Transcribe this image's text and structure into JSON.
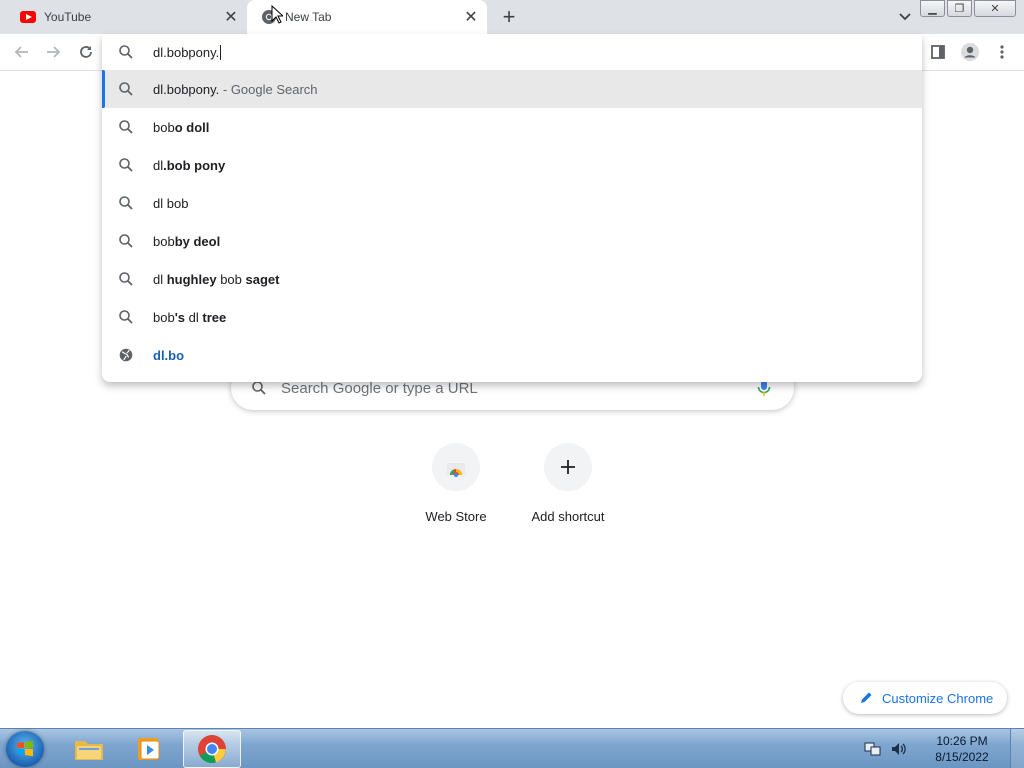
{
  "tabs": [
    {
      "title": "YouTube",
      "active": false,
      "icon": "youtube-icon"
    },
    {
      "title": "New Tab",
      "active": true,
      "icon": "chrome-icon"
    }
  ],
  "omnibox": {
    "value": "dl.bobpony.",
    "suggestions": [
      {
        "icon": "search-icon",
        "plain": "dl.bobpony.",
        "bold": "",
        "desc": " - Google Search",
        "selected": true
      },
      {
        "icon": "search-icon",
        "segments": [
          "bob",
          "o doll"
        ]
      },
      {
        "icon": "search-icon",
        "segments": [
          "dl",
          ".bob pony"
        ]
      },
      {
        "icon": "search-icon",
        "segments": [
          "dl bob",
          ""
        ]
      },
      {
        "icon": "search-icon",
        "segments": [
          "bob",
          "by deol"
        ]
      },
      {
        "icon": "search-icon",
        "segments": [
          "dl ",
          "hughley",
          " bob ",
          "saget"
        ]
      },
      {
        "icon": "search-icon",
        "segments": [
          "bob",
          "'s",
          " dl ",
          "tree"
        ]
      },
      {
        "icon": "globe-icon",
        "url": "dl.bo"
      }
    ]
  },
  "ntp": {
    "search_placeholder": "Search Google or type a URL",
    "shortcuts": [
      {
        "label": "Web Store",
        "icon": "web-store-icon"
      },
      {
        "label": "Add shortcut",
        "icon": "plus-icon"
      }
    ],
    "customize_label": "Customize Chrome"
  },
  "taskbar": {
    "time": "10:26 PM",
    "date": "8/15/2022",
    "apps": [
      "explorer-icon",
      "media-player-icon",
      "chrome-icon"
    ]
  },
  "colors": {
    "accent": "#1a73e8",
    "tabstrip": "#dee1e6",
    "youtube_red": "#ff0000"
  }
}
